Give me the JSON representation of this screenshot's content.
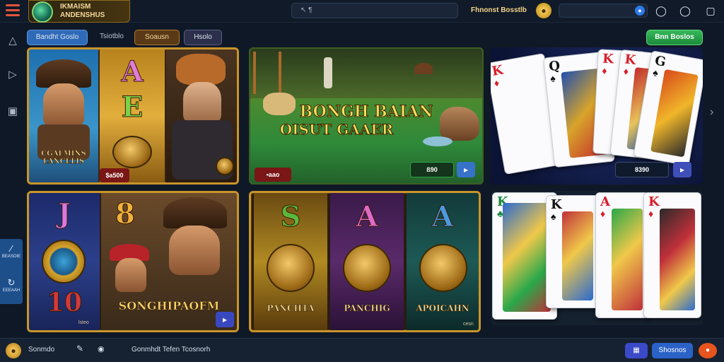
{
  "header": {
    "logo_text": "IKMAISM\nANDENSHUS",
    "search_text": "↖ ¶",
    "bonus_label": "Fhnonst Bosstlb",
    "coin_glyph": "●",
    "balance_glyph": "●"
  },
  "tabs": [
    {
      "label": "Bandht Goslo"
    },
    {
      "label": "Tsiotblo"
    },
    {
      "label": "Soausn"
    },
    {
      "label": "Hsolo"
    }
  ],
  "cta_label": "Bnn Boslos",
  "side_dock": [
    {
      "glyph": "∕",
      "label": "BEASOIE"
    },
    {
      "glyph": "↻",
      "label": "EEEAAH"
    }
  ],
  "tiles": {
    "slot_one": {
      "title": "CGALMINS\nLANCELIS",
      "letter_a": "A",
      "letter_b": "E",
      "chip_label": "$a500"
    },
    "slot_two": {
      "title_line1": "BONGH BAIAN",
      "title_line2": "OISUT GAAER",
      "chip_label": "•aao",
      "amount_label": "ß90"
    },
    "cards_one": {
      "amount_label": "8390",
      "cards": [
        {
          "rank": "K",
          "suit": "♦"
        },
        {
          "rank": "Q",
          "suit": "♠"
        },
        {
          "rank": "K",
          "suit": "♦"
        },
        {
          "rank": "K",
          "suit": "♦"
        },
        {
          "rank": "G",
          "suit": "♠"
        }
      ]
    },
    "slot_three": {
      "letter_a": "J",
      "letter_b": "8",
      "letter_c": "10",
      "title": "SONGHIPAOFM",
      "small_label": "lsteo"
    },
    "slot_four": {
      "reels": [
        {
          "letter": "S",
          "label": "PANCHTA"
        },
        {
          "letter": "A",
          "label": "PANCHIG"
        },
        {
          "letter": "A",
          "label": "APOICAHN"
        }
      ],
      "small_label": "cesn"
    },
    "cards_two": {
      "cards": [
        {
          "rank": "K",
          "suit": "♣"
        },
        {
          "rank": "K",
          "suit": "♠"
        },
        {
          "rank": "A",
          "suit": "♦"
        },
        {
          "rank": "K",
          "suit": "♦"
        }
      ]
    }
  },
  "footer": {
    "user_label": "Sonmdo",
    "links_label": "Gonmhdt Tefen Tcosnorh",
    "badge_glyph": "◉",
    "btn_label": "Shosnos"
  },
  "colors": {
    "accent_green": "#2cae55",
    "accent_blue": "#2f6ab8",
    "gold": "#c8952c"
  }
}
